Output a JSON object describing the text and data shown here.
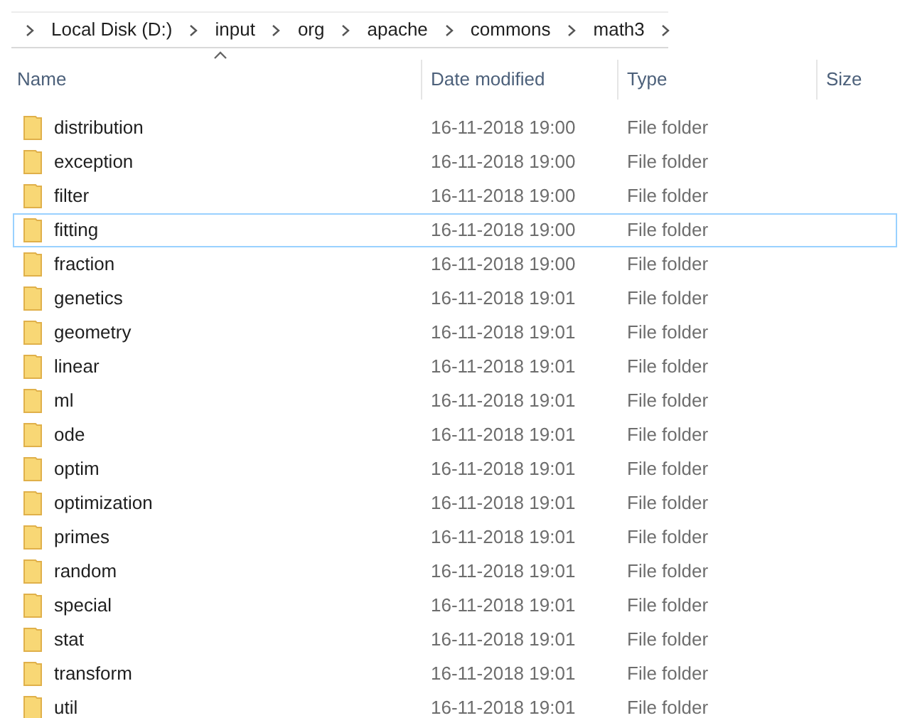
{
  "breadcrumb": [
    "Local Disk (D:)",
    "input",
    "org",
    "apache",
    "commons",
    "math3"
  ],
  "columns": [
    {
      "label": "Name",
      "sorted": true
    },
    {
      "label": "Date modified",
      "sorted": false
    },
    {
      "label": "Type",
      "sorted": false
    },
    {
      "label": "Size",
      "sorted": false
    }
  ],
  "rows": [
    {
      "name": "distribution",
      "date": "16-11-2018 19:00",
      "type": "File folder",
      "focused": false
    },
    {
      "name": "exception",
      "date": "16-11-2018 19:00",
      "type": "File folder",
      "focused": false
    },
    {
      "name": "filter",
      "date": "16-11-2018 19:00",
      "type": "File folder",
      "focused": false
    },
    {
      "name": "fitting",
      "date": "16-11-2018 19:00",
      "type": "File folder",
      "focused": true
    },
    {
      "name": "fraction",
      "date": "16-11-2018 19:00",
      "type": "File folder",
      "focused": false
    },
    {
      "name": "genetics",
      "date": "16-11-2018 19:01",
      "type": "File folder",
      "focused": false
    },
    {
      "name": "geometry",
      "date": "16-11-2018 19:01",
      "type": "File folder",
      "focused": false
    },
    {
      "name": "linear",
      "date": "16-11-2018 19:01",
      "type": "File folder",
      "focused": false
    },
    {
      "name": "ml",
      "date": "16-11-2018 19:01",
      "type": "File folder",
      "focused": false
    },
    {
      "name": "ode",
      "date": "16-11-2018 19:01",
      "type": "File folder",
      "focused": false
    },
    {
      "name": "optim",
      "date": "16-11-2018 19:01",
      "type": "File folder",
      "focused": false
    },
    {
      "name": "optimization",
      "date": "16-11-2018 19:01",
      "type": "File folder",
      "focused": false
    },
    {
      "name": "primes",
      "date": "16-11-2018 19:01",
      "type": "File folder",
      "focused": false
    },
    {
      "name": "random",
      "date": "16-11-2018 19:01",
      "type": "File folder",
      "focused": false
    },
    {
      "name": "special",
      "date": "16-11-2018 19:01",
      "type": "File folder",
      "focused": false
    },
    {
      "name": "stat",
      "date": "16-11-2018 19:01",
      "type": "File folder",
      "focused": false
    },
    {
      "name": "transform",
      "date": "16-11-2018 19:01",
      "type": "File folder",
      "focused": false
    },
    {
      "name": "util",
      "date": "16-11-2018 19:01",
      "type": "File folder",
      "focused": false
    }
  ]
}
